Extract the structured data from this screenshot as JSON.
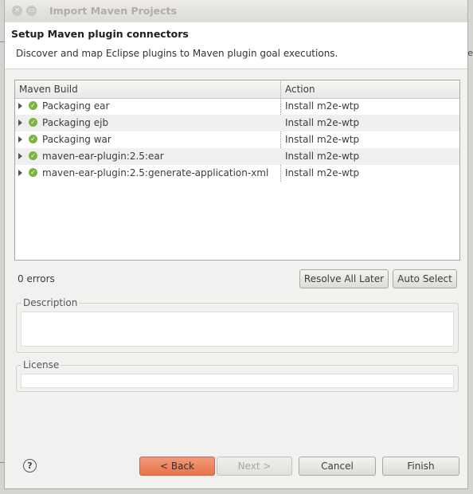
{
  "window": {
    "title": "Import Maven Projects",
    "close_glyph": "×",
    "min_glyph": "▭"
  },
  "header": {
    "title": "Setup Maven plugin connectors",
    "description": "Discover and map Eclipse plugins to Maven plugin goal executions."
  },
  "table": {
    "columns": [
      "Maven Build",
      "Action"
    ],
    "rows": [
      {
        "build": "Packaging ear",
        "action": "Install m2e-wtp"
      },
      {
        "build": "Packaging ejb",
        "action": "Install m2e-wtp"
      },
      {
        "build": "Packaging war",
        "action": "Install m2e-wtp"
      },
      {
        "build": "maven-ear-plugin:2.5:ear",
        "action": "Install m2e-wtp"
      },
      {
        "build": "maven-ear-plugin:2.5:generate-application-xml",
        "action": "Install m2e-wtp"
      }
    ]
  },
  "status": {
    "errors": "0 errors"
  },
  "buttons": {
    "resolve_all_later": "Resolve All Later",
    "auto_select": "Auto Select",
    "back": "< Back",
    "next": "Next >",
    "cancel": "Cancel",
    "finish": "Finish"
  },
  "groups": {
    "description": "Description",
    "license": "License"
  },
  "help": {
    "glyph": "?"
  },
  "background_fragments": {
    "right_header": "e"
  },
  "colors": {
    "accent_button": "#e8734a",
    "ok_icon": "#7cb342"
  }
}
